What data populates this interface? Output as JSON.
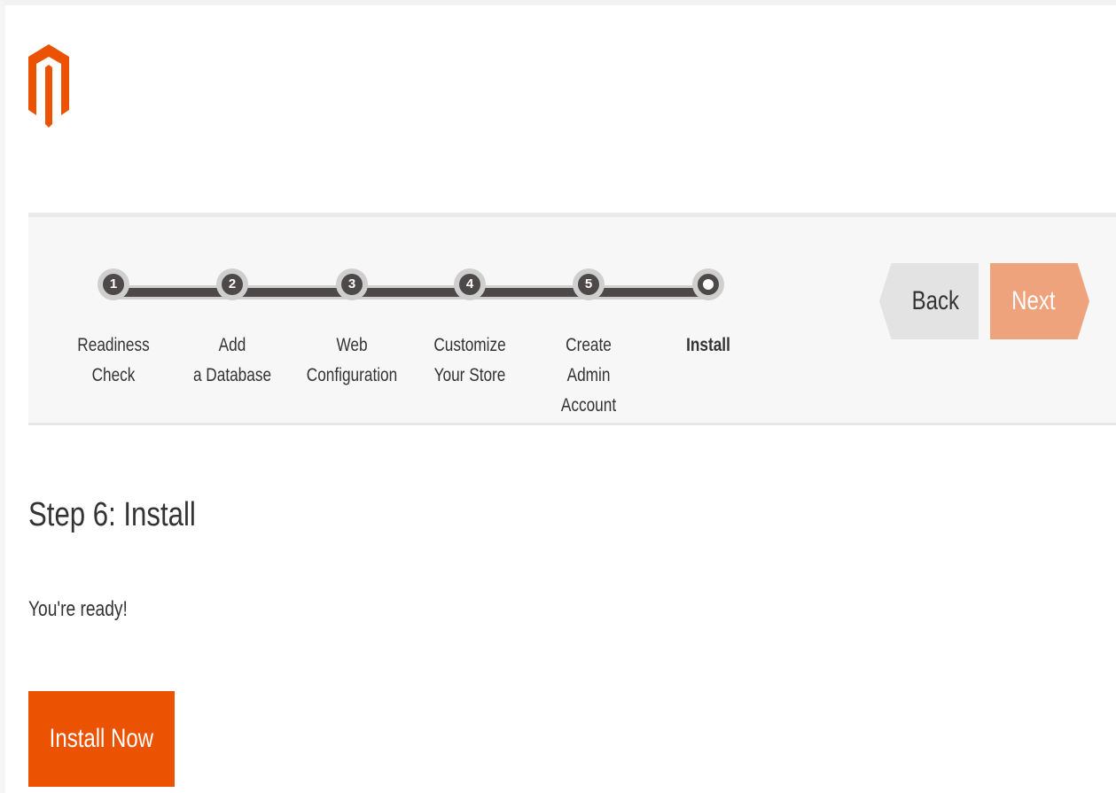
{
  "brand": {
    "logo_icon": "magento-logo-icon",
    "accent_color": "#eb5202"
  },
  "progress": {
    "steps": [
      {
        "number": "1",
        "label_line1": "Readiness",
        "label_line2": "Check",
        "status": "done"
      },
      {
        "number": "2",
        "label_line1": "Add",
        "label_line2": "a Database",
        "status": "done"
      },
      {
        "number": "3",
        "label_line1": "Web",
        "label_line2": "Configuration",
        "status": "done"
      },
      {
        "number": "4",
        "label_line1": "Customize",
        "label_line2": "Your Store",
        "status": "done"
      },
      {
        "number": "5",
        "label_line1": "Create",
        "label_line2": "Admin Account",
        "status": "done"
      },
      {
        "number": "",
        "label_line1": "Install",
        "label_line2": "",
        "status": "current"
      }
    ]
  },
  "nav": {
    "back_label": "Back",
    "next_label": "Next",
    "next_color": "#efa37c"
  },
  "main": {
    "title": "Step 6: Install",
    "ready_text": "You're ready!",
    "install_button_label": "Install Now"
  }
}
